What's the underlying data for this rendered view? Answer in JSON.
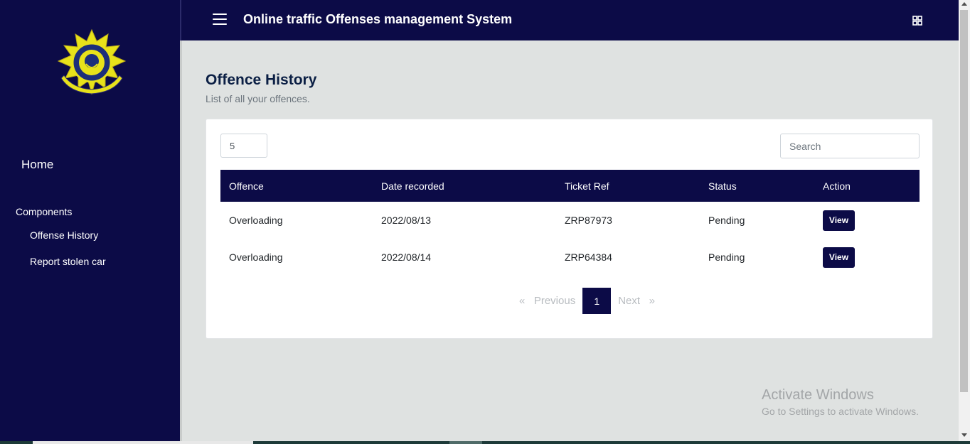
{
  "app": {
    "title": "Online traffic Offenses management System"
  },
  "sidebar": {
    "home": "Home",
    "section_heading": "Components",
    "items": [
      {
        "label": "Offense History"
      },
      {
        "label": "Report stolen car"
      }
    ]
  },
  "page": {
    "title": "Offence History",
    "subtitle": "List of all your offences."
  },
  "table_controls": {
    "per_page": "5",
    "search_placeholder": "Search"
  },
  "table": {
    "columns": [
      "Offence",
      "Date recorded",
      "Ticket Ref",
      "Status",
      "Action"
    ],
    "rows": [
      {
        "offence": "Overloading",
        "date": "2022/08/13",
        "ticket": "ZRP87973",
        "status": "Pending",
        "action": "View"
      },
      {
        "offence": "Overloading",
        "date": "2022/08/14",
        "ticket": "ZRP64384",
        "status": "Pending",
        "action": "View"
      }
    ]
  },
  "pagination": {
    "prev": "«   Previous",
    "current": "1",
    "next": "Next   »"
  },
  "watermark": {
    "line1": "Activate Windows",
    "line2": "Go to Settings to activate Windows."
  },
  "colors": {
    "navy": "#0c0b47",
    "page_bg": "#dfe2e1",
    "title": "#0b1f44"
  }
}
